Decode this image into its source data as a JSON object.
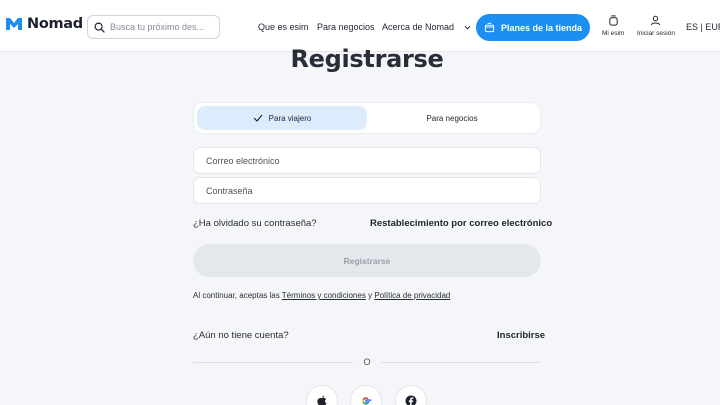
{
  "header": {
    "logo_text": "Nomad",
    "search_placeholder": "Busca tu próximo des...",
    "nav": {
      "que_es_esim": "Que es esim",
      "para_negocios": "Para negocios",
      "acerca": "Acerca de Nomad"
    },
    "store_button": "Planes de la tienda",
    "mi_esim": "Mi esim",
    "iniciar_sesion": "Iniciar sesión",
    "language": "ES | EUR"
  },
  "page": {
    "title": "Registrarse",
    "tabs": [
      "Para viajero",
      "Para negocios"
    ],
    "active_tab": "Para viajero",
    "email_placeholder": "Correo electrónico",
    "password_placeholder": "Contraseña",
    "forgot": "¿Ha olvidado su contraseña?",
    "reset": "Restablecimiento por correo electrónico",
    "submit": "Registrarse",
    "terms_prefix": "Al continuar, aceptas las",
    "terms_link": "Términos y condiciones",
    "terms_and": "y",
    "privacy_link": "Política de privacidad",
    "no_account": "¿Aún no tiene cuenta?",
    "signup": "Inscribirse",
    "divider_text": "O",
    "social": [
      "apple-icon",
      "google-icon",
      "facebook-icon"
    ]
  },
  "colors": {
    "accent": "#1b8ff2",
    "tab_active": "#dcecfd",
    "button_disabled": "#e4e7ec"
  }
}
